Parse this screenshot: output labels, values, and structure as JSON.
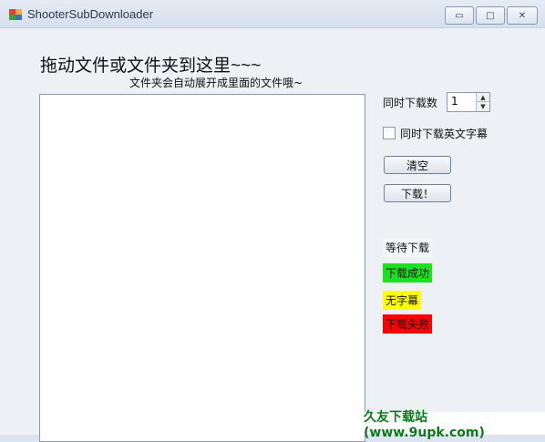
{
  "window": {
    "title": "ShooterSubDownloader",
    "controls": {
      "minimize": "▭",
      "maximize": "□",
      "close": "✕"
    }
  },
  "main": {
    "heading": "拖动文件或文件夹到这里~~~",
    "subheading": "文件夹会自动展开成里面的文件哦~"
  },
  "side": {
    "concurrent_label": "同时下载数",
    "concurrent_value": "1",
    "english_label": "同时下载英文字幕",
    "english_checked": false,
    "clear_button": "清空",
    "download_button": "下载！"
  },
  "legend": {
    "waiting": "等待下载",
    "success": "下载成功",
    "none": "无字幕",
    "failed": "下载失败"
  },
  "colors": {
    "success": "#19e31e",
    "none": "#ffff00",
    "failed": "#ff0000"
  },
  "watermark": "久友下载站(www.9upk.com)"
}
